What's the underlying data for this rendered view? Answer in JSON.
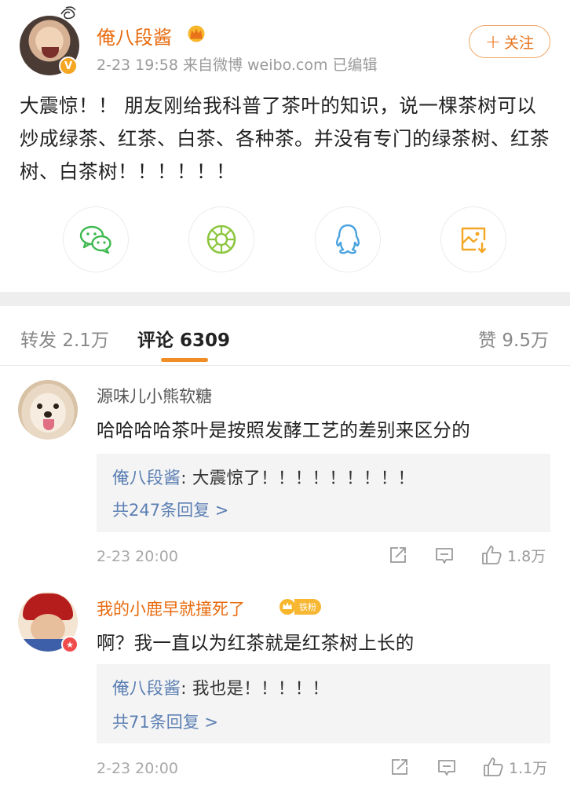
{
  "post": {
    "author": "俺八段酱",
    "verified_badge": "V",
    "meta": "2-23 19:58  来自微博 weibo.com  已编辑",
    "follow_label": "关注",
    "follow_plus": "+",
    "text": "大震惊！！ 朋友刚给我科普了茶叶的知识，说一棵茶树可以炒成绿茶、红茶、白茶、各种茶。并没有专门的绿茶树、红茶树、白茶树！！！！！！",
    "share_icons": [
      "wechat-icon",
      "moments-icon",
      "qq-icon",
      "save-image-icon"
    ]
  },
  "tabs": {
    "repost_label": "转发",
    "repost_count": "2.1万",
    "comment_label": "评论",
    "comment_count": "6309",
    "like_label": "赞",
    "like_count": "9.5万"
  },
  "comments": [
    {
      "user": "源味儿小熊软糖",
      "text": "哈哈哈哈茶叶是按照发酵工艺的差别来区分的",
      "reply_author": "俺八段酱",
      "reply_text": "大震惊了！！！！！！！！！",
      "reply_more": "共247条回复 >",
      "time": "2-23 20:00",
      "likes": "1.8万"
    },
    {
      "user": "我的小鹿早就撞死了",
      "fan_tag": "铁粉",
      "text": "啊？我一直以为红茶就是红茶树上长的",
      "reply_author": "俺八段酱",
      "reply_text": "我也是！！！！！",
      "reply_more": "共71条回复 >",
      "time": "2-23 20:00",
      "likes": "1.1万"
    }
  ],
  "colors": {
    "accent_orange": "#e86b0f",
    "link_blue": "#5b7fb3",
    "wechat_green": "#3fb950",
    "moments_green": "#8cc63f",
    "qq_blue": "#4aa3df",
    "save_orange": "#f5a623"
  }
}
